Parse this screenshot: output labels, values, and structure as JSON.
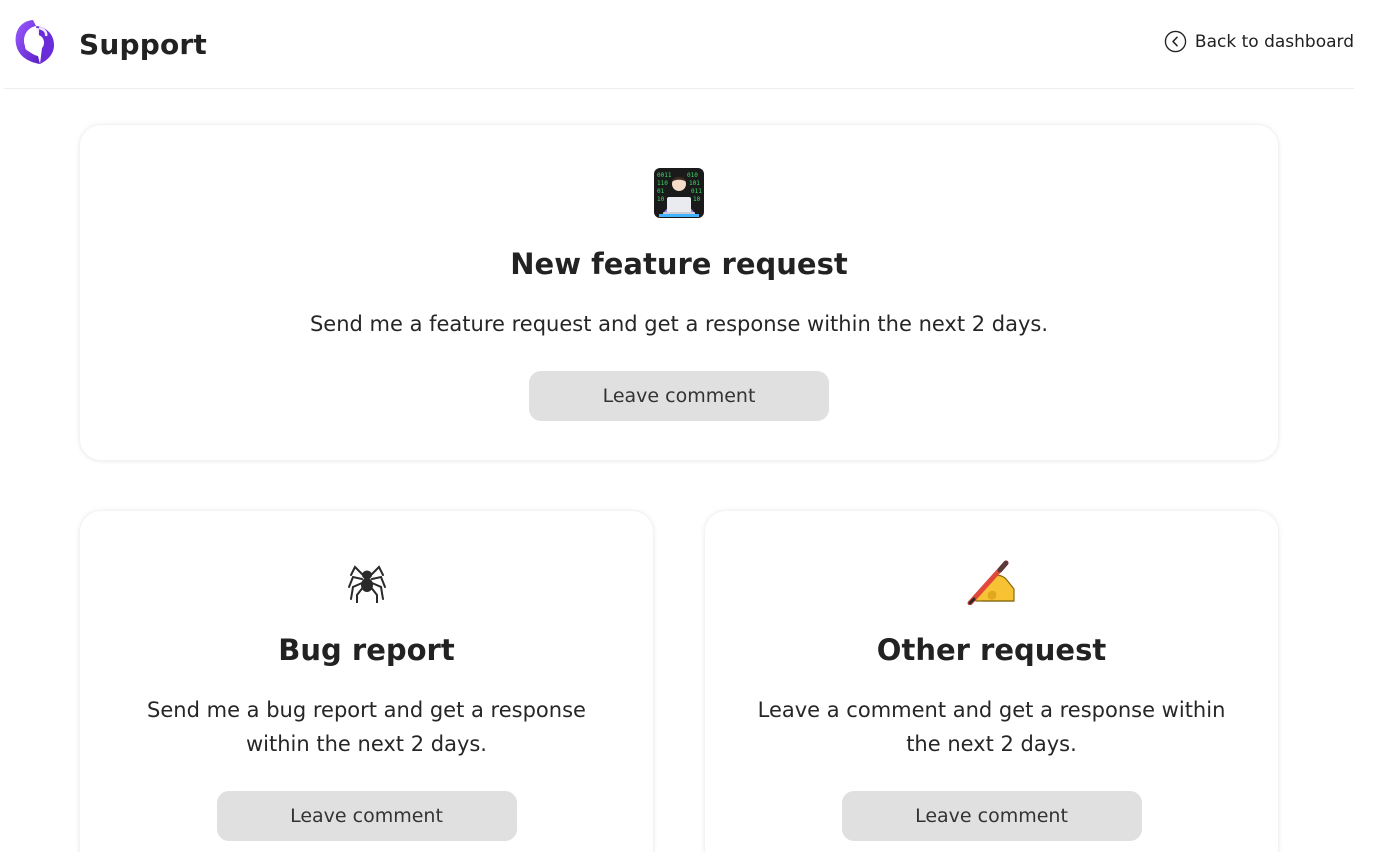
{
  "header": {
    "title": "Support",
    "logo_icon": "brand-logo-icon",
    "back_label": "Back to dashboard",
    "back_icon": "chevron-left-circle-icon"
  },
  "colors": {
    "logo_primary": "#6a2bd9",
    "logo_secondary": "#8f4bff",
    "button_bg": "#e0e0e0",
    "text": "#222222"
  },
  "cards": [
    {
      "icon": "technologist-icon",
      "heading": "New feature request",
      "description": "Send me a feature request and get a response within the next 2 days.",
      "button_label": "Leave comment"
    },
    {
      "icon": "spider-icon",
      "heading": "Bug report",
      "description": "Send me a bug report and get a response within the next 2 days.",
      "button_label": "Leave comment"
    },
    {
      "icon": "writing-hand-icon",
      "heading": "Other request",
      "description": "Leave a comment and get a response within the next 2 days.",
      "button_label": "Leave comment"
    }
  ]
}
